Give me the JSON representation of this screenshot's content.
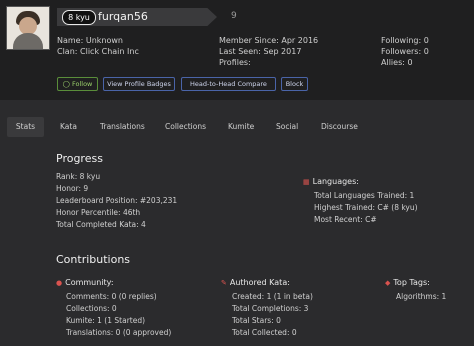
{
  "profile": {
    "rank": "8 kyu",
    "username": "furqan56",
    "honor": "9",
    "name": "Name: Unknown",
    "clan": "Clan: Click Chain Inc",
    "member_since": "Member Since: Apr 2016",
    "last_seen": "Last Seen: Sep 2017",
    "profiles": "Profiles:",
    "following": "Following: 0",
    "followers": "Followers: 0",
    "allies": "Allies: 0"
  },
  "buttons": {
    "follow": "Follow",
    "badges": "View Profile Badges",
    "compare": "Head-to-Head Compare",
    "block": "Block"
  },
  "tabs": [
    "Stats",
    "Kata",
    "Translations",
    "Collections",
    "Kumite",
    "Social",
    "Discourse"
  ],
  "progress": {
    "title": "Progress",
    "rank": "Rank: 8 kyu",
    "honor": "Honor: 9",
    "leaderboard": "Leaderboard Position: #203,231",
    "percentile": "Honor Percentile: 46th",
    "completed": "Total Completed Kata: 4"
  },
  "languages": {
    "title": "Languages:",
    "trained": "Total Languages Trained: 1",
    "highest": "Highest Trained: C# (8 kyu)",
    "recent": "Most Recent: C#"
  },
  "contributions": {
    "title": "Contributions",
    "community": {
      "title": "Community:",
      "comments": "Comments: 0 (0 replies)",
      "collections": "Collections: 0",
      "kumite": "Kumite: 1 (1 Started)",
      "translations": "Translations: 0 (0 approved)"
    },
    "authored": {
      "title": "Authored Kata:",
      "created": "Created: 1 (1 in beta)",
      "completions": "Total Completions: 3",
      "stars": "Total Stars: 0",
      "collected": "Total Collected: 0"
    },
    "tags": {
      "title": "Top Tags:",
      "algorithms": "Algorithms: 1"
    }
  },
  "colors": {
    "background": "#2b2b2d",
    "header": "#1f1f20",
    "accent_red": "#d9534f",
    "follow_green": "#9bd16b",
    "button_blue": "#4a64a8"
  }
}
